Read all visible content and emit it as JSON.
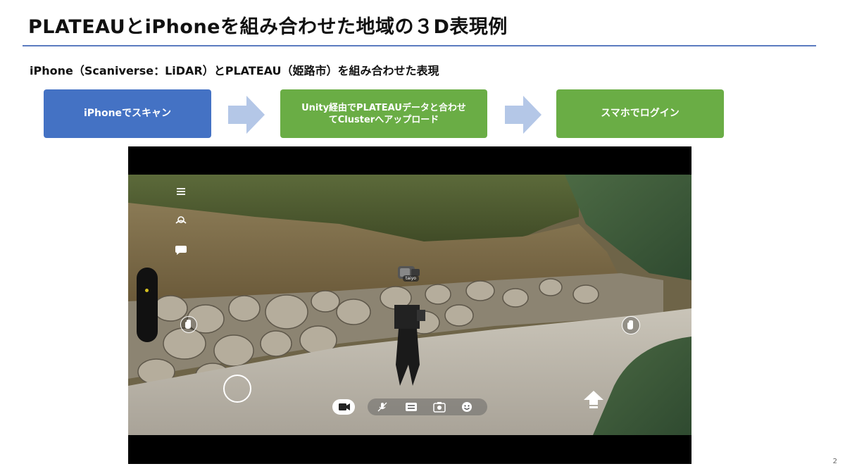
{
  "slide": {
    "title": "PLATEAUとiPhoneを組み合わせた地域の３D表現例",
    "subtitle": "iPhone（Scaniverse：LiDAR）とPLATEAU（姫路市）を組み合わせた表現",
    "page_number": "2"
  },
  "flow": {
    "steps": [
      {
        "label": "iPhoneでスキャン",
        "color": "#4472c4"
      },
      {
        "label": "Unity経由でPLATEAUデータと合わせ\nてClusterへアップロード",
        "color": "#6aad45"
      },
      {
        "label": "スマホでログイン",
        "color": "#6aad45"
      }
    ],
    "arrow_color": "#b4c7e7"
  },
  "app_screenshot": {
    "avatar_nametag": "taiyo",
    "left_controls": [
      "menu-icon",
      "user-icon",
      "chat-icon"
    ],
    "bottom_toolbar": [
      "camera-icon",
      "mic-muted-icon",
      "switch-icon",
      "photo-icon",
      "emoji-icon"
    ],
    "right_controls": [
      "hand-icon",
      "jump-arrow-icon"
    ]
  }
}
